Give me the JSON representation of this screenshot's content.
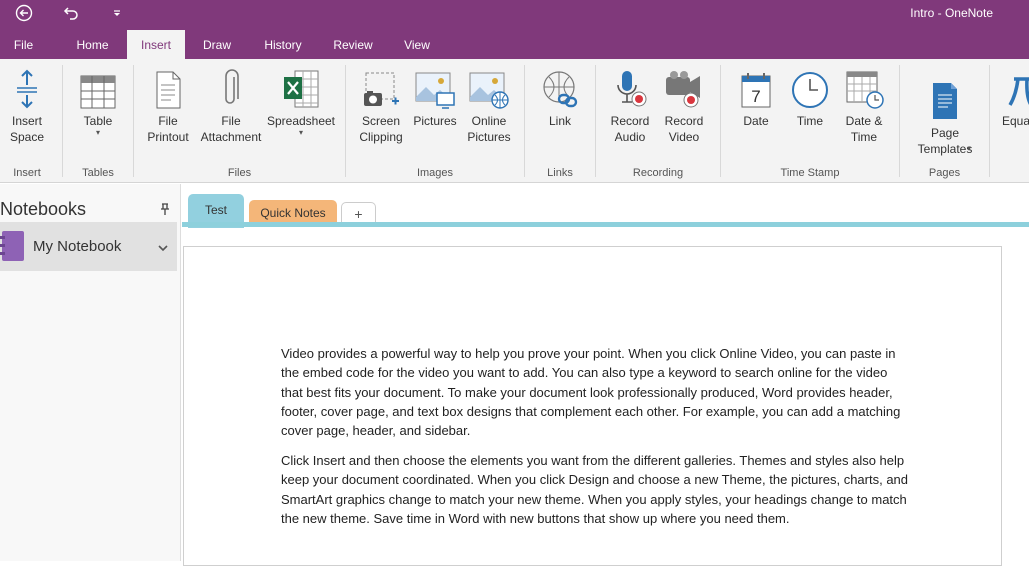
{
  "app": {
    "title": "Intro - OneNote"
  },
  "quick_access": {
    "back": "back-icon",
    "undo": "undo-icon",
    "customize": "customize-icon"
  },
  "menu_tabs": [
    "File",
    "Home",
    "Insert",
    "Draw",
    "History",
    "Review",
    "View"
  ],
  "active_tab": "Insert",
  "ribbon": {
    "buttons": {
      "insert_space": "Insert\nSpace",
      "table": "Table",
      "file_printout": "File\nPrintout",
      "file_attachment": "File\nAttachment",
      "spreadsheet": "Spreadsheet",
      "screen_clipping": "Screen\nClipping",
      "pictures": "Pictures",
      "online_pictures": "Online\nPictures",
      "link": "Link",
      "record_audio": "Record\nAudio",
      "record_video": "Record\nVideo",
      "date": "Date",
      "time": "Time",
      "date_time": "Date &\nTime",
      "page_templates": "Page\nTemplates",
      "equation": "Equa"
    },
    "groups": {
      "insert": "Insert",
      "tables": "Tables",
      "files": "Files",
      "images": "Images",
      "links": "Links",
      "recording": "Recording",
      "time_stamp": "Time Stamp",
      "pages": "Pages"
    },
    "date_icon_number": "7"
  },
  "colors": {
    "brand": "#80397b",
    "section_test": "#92d0df",
    "section_quick_notes": "#f4b679"
  },
  "notebooks": {
    "title": "Notebooks",
    "items": [
      {
        "label": "My Notebook"
      }
    ]
  },
  "section_tabs": [
    {
      "label": "Test"
    },
    {
      "label": "Quick Notes"
    }
  ],
  "add_section": "+",
  "page": {
    "paragraphs": [
      "Video provides a powerful way to help you prove your point. When you click Online Video, you can paste in the embed code for the video you want to add. You can also type a keyword to search online for the video that best fits your document. To make your document look professionally produced, Word provides header, footer, cover page, and text box designs that complement each other. For example, you can add a matching cover page, header, and sidebar.",
      "Click Insert and then choose the elements you want from the different galleries. Themes and styles also help keep your document coordinated. When you click Design and choose a new Theme, the pictures, charts, and SmartArt graphics change to match your new theme. When you apply styles, your headings change to match the new theme. Save time in Word with new buttons that show up where you need them."
    ]
  }
}
